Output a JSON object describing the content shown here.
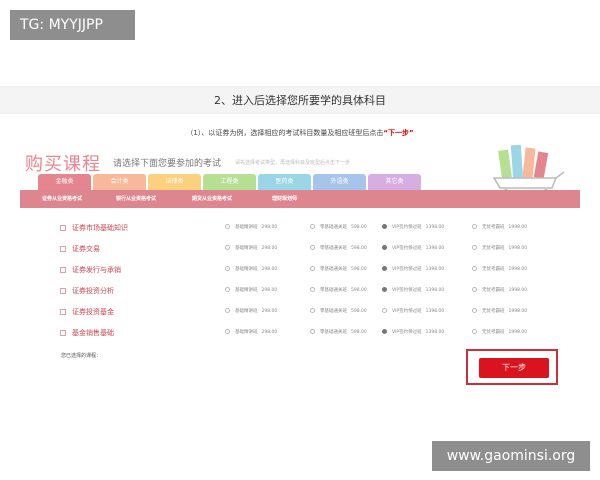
{
  "watermarks": {
    "top_left": "TG: MYYJJPP",
    "bottom_right": "www.gaominsi.org"
  },
  "step": {
    "title": "2、进入后选择您所要学的具体科目"
  },
  "instruction": {
    "prefix": "（1）、以证券为例，选择相应的考试科目数量及相应班型后点击",
    "highlight": "“下一步”"
  },
  "panel": {
    "title": "购买课程",
    "subtitle": "请选择下面您要参加的考试",
    "hint": "请先选择考试类型，再选择科目及班型后点击下一步",
    "tabs": [
      {
        "label": "金融类",
        "active": true
      },
      {
        "label": "会计类",
        "active": false
      },
      {
        "label": "法律类",
        "active": false
      },
      {
        "label": "工程类",
        "active": false
      },
      {
        "label": "医药类",
        "active": false
      },
      {
        "label": "外语类",
        "active": false
      },
      {
        "label": "其它类",
        "active": false
      }
    ],
    "categories": [
      "证券从业资格考试",
      "银行从业资格考试",
      "期货从业资格考试",
      "理财规划师"
    ],
    "courses": [
      {
        "name": "证券市场基础知识",
        "options": [
          {
            "label": "基础精讲班",
            "price": "298.00",
            "checked": false
          },
          {
            "label": "零基础通关班",
            "price": "598.00",
            "checked": false
          },
          {
            "label": "VIP签约保过班",
            "price": "1398.00",
            "checked": true
          },
          {
            "label": "无忧考霸班",
            "price": "1998.00",
            "checked": false
          }
        ]
      },
      {
        "name": "证券交易",
        "options": [
          {
            "label": "基础精讲班",
            "price": "298.00",
            "checked": false
          },
          {
            "label": "零基础通关班",
            "price": "598.00",
            "checked": false
          },
          {
            "label": "VIP签约保过班",
            "price": "1398.00",
            "checked": true
          },
          {
            "label": "无忧考霸班",
            "price": "1998.00",
            "checked": false
          }
        ]
      },
      {
        "name": "证券发行与承销",
        "options": [
          {
            "label": "基础精讲班",
            "price": "298.00",
            "checked": false
          },
          {
            "label": "零基础通关班",
            "price": "598.00",
            "checked": false
          },
          {
            "label": "VIP签约保过班",
            "price": "1398.00",
            "checked": true
          },
          {
            "label": "无忧考霸班",
            "price": "1998.00",
            "checked": false
          }
        ]
      },
      {
        "name": "证券投资分析",
        "options": [
          {
            "label": "基础精讲班",
            "price": "298.00",
            "checked": false
          },
          {
            "label": "零基础通关班",
            "price": "598.00",
            "checked": false
          },
          {
            "label": "VIP签约保过班",
            "price": "1398.00",
            "checked": true
          },
          {
            "label": "无忧考霸班",
            "price": "1998.00",
            "checked": false
          }
        ]
      },
      {
        "name": "证券投资基金",
        "options": [
          {
            "label": "基础精讲班",
            "price": "298.00",
            "checked": false
          },
          {
            "label": "零基础通关班",
            "price": "598.00",
            "checked": false
          },
          {
            "label": "VIP签约保过班",
            "price": "1398.00",
            "checked": false
          },
          {
            "label": "无忧考霸班",
            "price": "1998.00",
            "checked": false
          }
        ]
      },
      {
        "name": "基金销售基础",
        "options": [
          {
            "label": "基础精讲班",
            "price": "298.00",
            "checked": false
          },
          {
            "label": "零基础通关班",
            "price": "598.00",
            "checked": false
          },
          {
            "label": "VIP签约保过班",
            "price": "1398.00",
            "checked": true
          },
          {
            "label": "无忧考霸班",
            "price": "1998.00",
            "checked": false
          }
        ]
      }
    ],
    "chosen_label": "您已选择的课程：",
    "next_button": "下一步"
  },
  "colors": {
    "accent": "#d9141f",
    "tab_active": "#e5858f",
    "category_bar": "#dd8690",
    "course_name": "#d0444f"
  }
}
